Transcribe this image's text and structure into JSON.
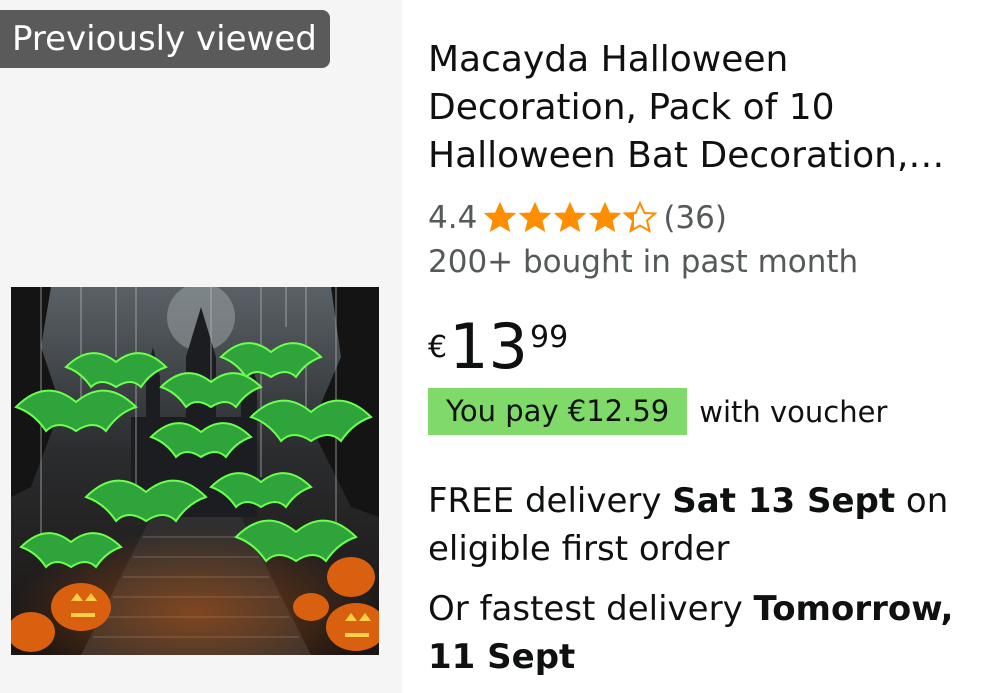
{
  "badge": {
    "label": "Previously viewed"
  },
  "product": {
    "image_icon": "halloween-bats-product-image",
    "title": "Macayda Halloween Decoration, Pack of 10 Halloween Bat Decoration,…",
    "rating": {
      "value": "4.4",
      "stars": 4.4,
      "count": "(36)",
      "color": "#ff8d00"
    },
    "bought": "200+ bought in past month",
    "price": {
      "symbol": "€",
      "whole": "13",
      "fraction": "99"
    },
    "voucher": {
      "badge": "You pay €12.59",
      "suffix": "with voucher",
      "color": "#7fda69"
    },
    "delivery": {
      "prefix": "FREE delivery ",
      "date": "Sat 13 Sept",
      "suffix": " on eligible first order"
    },
    "fastest": {
      "prefix": "Or fastest delivery ",
      "date": "Tomorrow, 11 Sept"
    }
  }
}
